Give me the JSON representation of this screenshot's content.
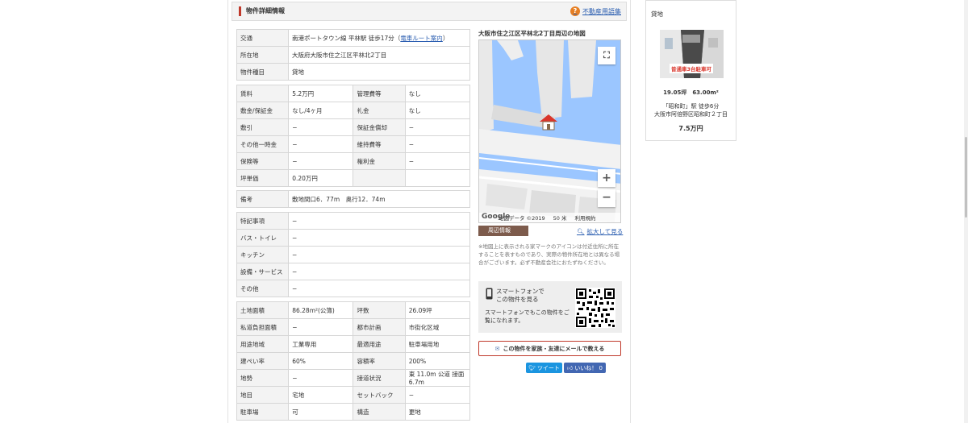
{
  "header": {
    "title": "物件詳細情報",
    "help_link": "不動産用語集"
  },
  "basic": {
    "access_label": "交通",
    "access_value": "南港ポートタウン線 平林駅 徒歩17分",
    "route_link": "電車ルート案内",
    "address_label": "所在地",
    "address_value": "大阪府大阪市住之江区平林北2丁目",
    "type_label": "物件種目",
    "type_value": "貸地"
  },
  "fees": [
    [
      "賃料",
      "5.2万円",
      "管理費等",
      "なし"
    ],
    [
      "敷金/保証金",
      "なし/4ヶ月",
      "礼金",
      "なし"
    ],
    [
      "敷引",
      "−",
      "保証金償却",
      "−"
    ],
    [
      "その他一時金",
      "−",
      "維持費等",
      "−"
    ],
    [
      "保険等",
      "−",
      "権利金",
      "−"
    ],
    [
      "坪単価",
      "0.20万円",
      "",
      ""
    ]
  ],
  "remarks": {
    "label": "備考",
    "value": "敷地間口6．77m　奥行12．74m"
  },
  "features": [
    [
      "特記事項",
      "−"
    ],
    [
      "バス・トイレ",
      "−"
    ],
    [
      "キッチン",
      "−"
    ],
    [
      "設備・サービス",
      "−"
    ],
    [
      "その他",
      "−"
    ]
  ],
  "land": [
    [
      "土地面積",
      "86.28m²(公簿)",
      "坪数",
      "26.09坪"
    ],
    [
      "私道負担面積",
      "−",
      "都市計画",
      "市街化区域"
    ],
    [
      "用途地域",
      "工業専用",
      "最適用途",
      "駐車場用地"
    ],
    [
      "建ぺい率",
      "60%",
      "容積率",
      "200%"
    ],
    [
      "地勢",
      "−",
      "接道状況",
      "東 11.0m 公道 接面6.7m"
    ],
    [
      "地目",
      "宅地",
      "セットバック",
      "−"
    ],
    [
      "駐車場",
      "可",
      "構造",
      "更地"
    ]
  ],
  "map": {
    "title": "大阪市住之江区平林北2丁目周辺の地図",
    "footer_data": "地図データ ©2019",
    "footer_scale": "50 米",
    "footer_terms": "利用規約",
    "google": "Google",
    "nearby_tab": "周辺情報",
    "zoom_link": "拡大して見る",
    "note": "※地図上に表示される家マークのアイコンは付近住所に所在することを表すものであり、実際の物件所在地とは異なる場合がございます。必ず不動産会社におたずねください。"
  },
  "smartphone": {
    "title_line1": "スマートフォンで",
    "title_line2": "この物件を見る",
    "desc": "スマートフォンでもこの物件をご覧になれます。"
  },
  "mail_button": "この物件を家族・友達にメールで教える",
  "tweet": "ツイート",
  "like": "いいね！ 0",
  "right_card": {
    "label": "貸地",
    "image_banner": "普通車3台駐車可",
    "meta": "19.05坪　63.00m²",
    "station_line1": "「昭和町」駅 徒歩6分",
    "station_line2": "大阪市阿倍野区昭和町２丁目",
    "price": "7.5万円"
  }
}
